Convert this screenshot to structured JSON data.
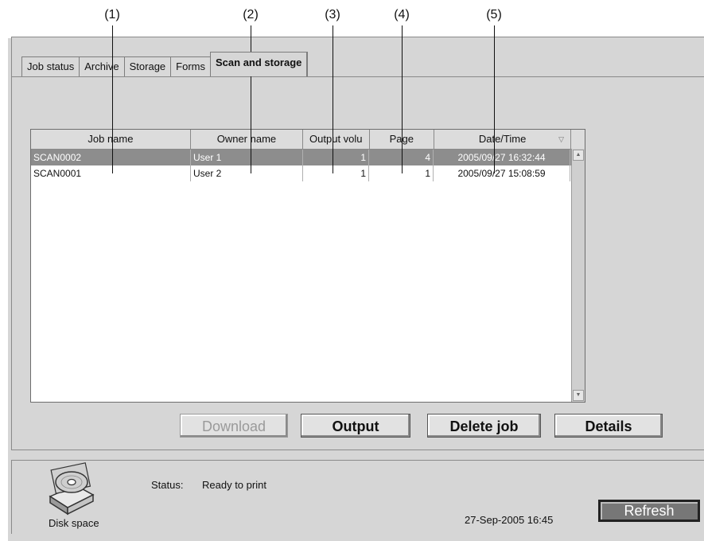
{
  "callouts": [
    "(1)",
    "(2)",
    "(3)",
    "(4)",
    "(5)"
  ],
  "tabs": [
    {
      "label": "Job status"
    },
    {
      "label": "Archive"
    },
    {
      "label": "Storage"
    },
    {
      "label": "Forms"
    },
    {
      "label": "Scan and storage"
    }
  ],
  "table": {
    "headers": [
      "Job name",
      "Owner name",
      "Output volu",
      "Page",
      "Date/Time"
    ],
    "rows": [
      {
        "job_name": "SCAN0002",
        "owner": "User 1",
        "output": "1",
        "page": "4",
        "datetime": "2005/09/27 16:32:44"
      },
      {
        "job_name": "SCAN0001",
        "owner": "User 2",
        "output": "1",
        "page": "1",
        "datetime": "2005/09/27 15:08:59"
      }
    ]
  },
  "buttons": {
    "download": "Download",
    "output": "Output",
    "delete": "Delete job",
    "details": "Details"
  },
  "status": {
    "disk_label": "Disk space",
    "label": "Status:",
    "value": "Ready to print",
    "datetime": "27-Sep-2005 16:45",
    "refresh": "Refresh"
  },
  "colors": {
    "background": "#d6d6d6",
    "selected_row": "#8d8d8d",
    "refresh_button": "#777777"
  }
}
